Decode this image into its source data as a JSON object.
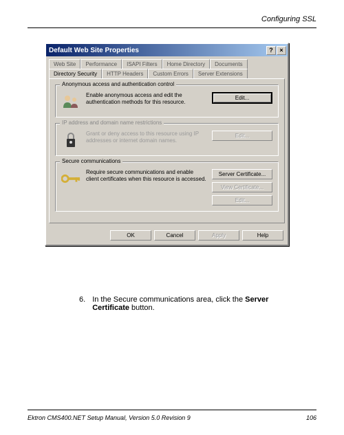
{
  "header": {
    "title": "Configuring SSL"
  },
  "dialog": {
    "title": "Default Web Site Properties",
    "help_btn": "?",
    "close_btn": "×",
    "tabs_row1": [
      "Web Site",
      "Performance",
      "ISAPI Filters",
      "Home Directory",
      "Documents"
    ],
    "tabs_row2": [
      "Directory Security",
      "HTTP Headers",
      "Custom Errors",
      "Server Extensions"
    ],
    "group1": {
      "title": "Anonymous access and authentication control",
      "text": "Enable anonymous access and edit the authentication methods for this resource.",
      "btn": "Edit..."
    },
    "group2": {
      "title": "IP address and domain name restrictions",
      "text": "Grant or deny access to this resource using IP addresses or internet domain names.",
      "btn": "Edit..."
    },
    "group3": {
      "title": "Secure communications",
      "text": "Require secure communications and enable client certificates when this resource is accessed.",
      "btn1": "Server Certificate...",
      "btn2": "View Certificate...",
      "btn3": "Edit..."
    },
    "buttons": {
      "ok": "OK",
      "cancel": "Cancel",
      "apply": "Apply",
      "help": "Help"
    }
  },
  "instruction": {
    "num": "6.",
    "text_pre": "In the Secure communications area, click the ",
    "text_bold": "Server Certificate",
    "text_post": " button."
  },
  "footer": {
    "left": "Ektron CMS400.NET Setup Manual, Version 5.0 Revision 9",
    "right": "106"
  }
}
